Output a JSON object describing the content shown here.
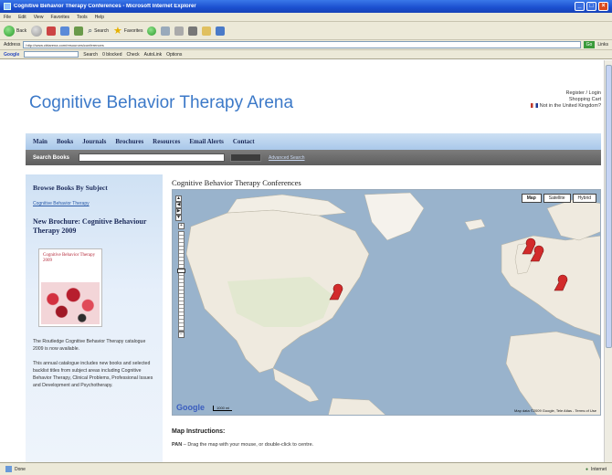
{
  "window": {
    "title": "Cognitive Behavior Therapy Conferences - Microsoft Internet Explorer"
  },
  "menubar": [
    "File",
    "Edit",
    "View",
    "Favorites",
    "Tools",
    "Help"
  ],
  "toolbar": {
    "back": "Back",
    "search": "Search",
    "favorites": "Favorites"
  },
  "addressbar": {
    "label": "Address",
    "url": "http://www.cbtarena.com/resources/conferences",
    "go": "Go",
    "links": "Links"
  },
  "googlebar": {
    "logo": "Google",
    "search": "Search",
    "blocked": "0 blocked",
    "check": "Check",
    "autolink": "AutoLink",
    "options": "Options"
  },
  "site": {
    "title": "Cognitive Behavior Therapy Arena",
    "register": "Register / Login",
    "cart": "Shopping Cart",
    "region": "Not in the United Kingdom?"
  },
  "nav": [
    "Main",
    "Books",
    "Journals",
    "Brochures",
    "Resources",
    "Email Alerts",
    "Contact"
  ],
  "search": {
    "label": "Search Books",
    "advanced": "Advanced Search"
  },
  "sidebar": {
    "browse_heading": "Browse Books By Subject",
    "browse_link": "Cognitive Behavior Therapy",
    "brochure_heading": "New Brochure: Cognitive Behaviour Therapy 2009",
    "cover_title": "Cognitive Behavior Therapy 2009",
    "para1": "The Routledge Cognitive Behavior Therapy catalogue 2009 is now available.",
    "para2": "This annual catalogue includes new books and selected backlist titles from subject areas including Cognitive Behavior Therapy, Clinical Problems, Professional Issues and Development and Psychotherapy."
  },
  "map": {
    "title": "Cognitive Behavior Therapy Conferences",
    "types": [
      "Map",
      "Satellite",
      "Hybrid"
    ],
    "google": "Google",
    "scale": "1000 mi",
    "copyright": "Map data ©2009 Google, Tele Atlas - Terms of Use"
  },
  "instructions": {
    "heading": "Map Instructions:",
    "pan_label": "PAN",
    "pan_text": " – Drag the map with your mouse, or double-click to centre."
  },
  "status": {
    "left": "Done",
    "right": "Internet"
  }
}
